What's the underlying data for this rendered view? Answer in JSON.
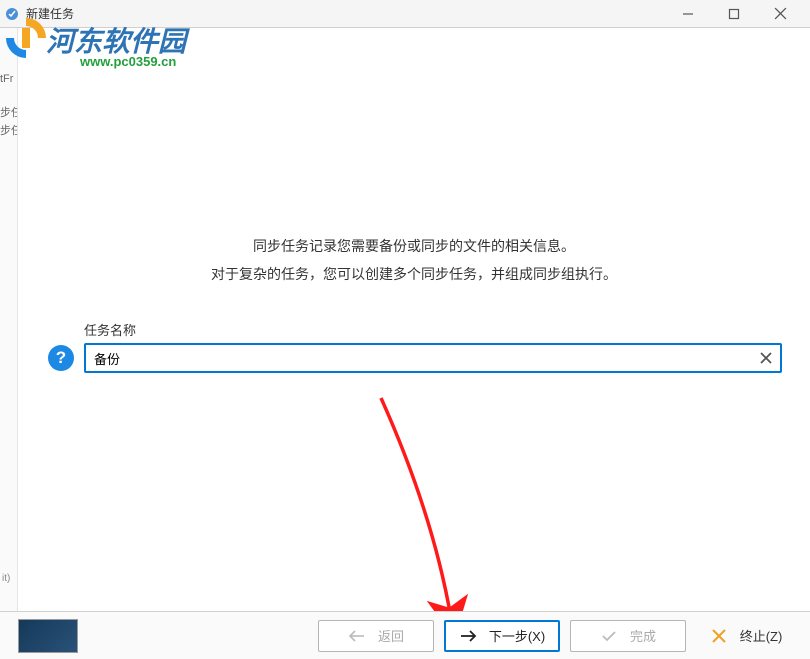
{
  "titlebar": {
    "title": "新建任务"
  },
  "watermark": {
    "text": "河东软件园",
    "url": "www.pc0359.cn"
  },
  "leftStrip": {
    "row1": "tFr",
    "row2": "步任",
    "row3": "步任",
    "bit": "it)"
  },
  "intro": {
    "line1": "同步任务记录您需要备份或同步的文件的相关信息。",
    "line2": "对于复杂的任务，您可以创建多个同步任务，并组成同步组执行。"
  },
  "form": {
    "label": "任务名称",
    "value": "备份"
  },
  "footer": {
    "back": "返回",
    "next": "下一步(X)",
    "finish": "完成",
    "terminate": "终止(Z)"
  }
}
